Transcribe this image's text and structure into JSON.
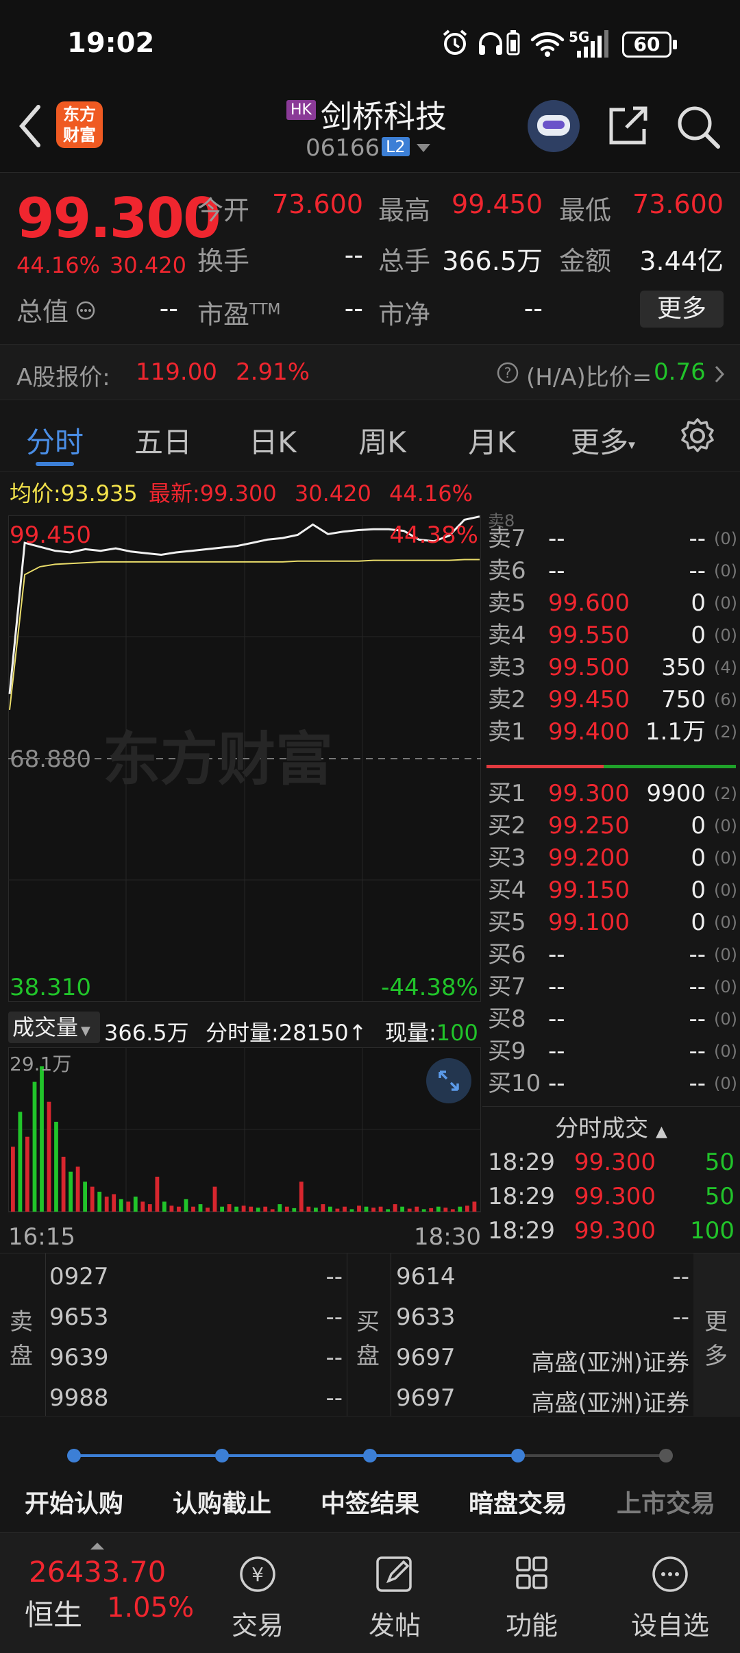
{
  "status_bar": {
    "time": "19:02",
    "network": "5G",
    "battery": "60",
    "icons": [
      "alarm-icon",
      "headphones-icon",
      "battery-saver-icon",
      "wifi-icon",
      "signal-icon",
      "battery-icon"
    ]
  },
  "header": {
    "logo_text_line1": "东方",
    "logo_text_line2": "财富",
    "market_badge": "HK",
    "stock_name": "剑桥科技",
    "stock_code": "06166",
    "level_badge": "L2"
  },
  "quote": {
    "price": "99.300",
    "change_pct": "44.16%",
    "change_amt": "30.420",
    "open_label": "今开",
    "open": "73.600",
    "high_label": "最高",
    "high": "99.450",
    "low_label": "最低",
    "low": "73.600",
    "turnover_rate_label": "换手",
    "turnover_rate": "--",
    "volume_label": "总手",
    "volume": "366.5万",
    "amount_label": "金额",
    "amount": "3.44亿",
    "market_cap_label": "总值",
    "market_cap": "--",
    "pe_label": "市盈",
    "pe_sup": "TTM",
    "pe": "--",
    "pb_label": "市净",
    "pb": "--",
    "more_button": "更多"
  },
  "a_share": {
    "label": "A股报价:",
    "price": "119.00",
    "pct": "2.91%",
    "ha_label": "(H/A)比价=",
    "ha_value": "0.76"
  },
  "tabs": [
    {
      "label": "分时",
      "active": true
    },
    {
      "label": "五日"
    },
    {
      "label": "日K"
    },
    {
      "label": "周K"
    },
    {
      "label": "月K"
    },
    {
      "label": "更多"
    }
  ],
  "avg_line": {
    "avg_label": "均价:",
    "avg": "93.935",
    "latest_label": "最新:",
    "latest": "99.300",
    "chg": "30.420",
    "pct": "44.16%"
  },
  "chart_data": {
    "type": "line",
    "y_top_label": "99.450",
    "y_mid_label": "68.880",
    "y_bottom_label": "38.310",
    "pct_top_label": "44.38%",
    "pct_bottom_label": "-44.38%",
    "watermark": "东方财富",
    "ylim": [
      38.31,
      99.45
    ],
    "series": [
      {
        "values": [
          77.0,
          96.0,
          95.5,
          95.0,
          94.8,
          95.2,
          95.0,
          95.3,
          94.9,
          94.7,
          94.5,
          94.8,
          95.0,
          95.2,
          95.4,
          95.6,
          96.0,
          96.4,
          96.6,
          97.0,
          98.3,
          97.1,
          97.4,
          97.6,
          97.7,
          97.7,
          97.5,
          96.4,
          96.2,
          96.9,
          98.9,
          99.3
        ]
      },
      {
        "values": [
          75.0,
          92.0,
          93.0,
          93.3,
          93.4,
          93.5,
          93.6,
          93.6,
          93.6,
          93.6,
          93.6,
          93.6,
          93.6,
          93.6,
          93.6,
          93.6,
          93.6,
          93.6,
          93.6,
          93.7,
          93.7,
          93.7,
          93.7,
          93.7,
          93.8,
          93.8,
          93.8,
          93.8,
          93.8,
          93.8,
          93.9,
          93.9
        ]
      }
    ],
    "volume": {
      "label": "成交量",
      "total": "366.5万",
      "period_label": "分时量:",
      "period": "28150",
      "current_label": "现量:",
      "current": "100",
      "y_max_label": "29.1万",
      "x_start": "16:15",
      "x_end": "18:30",
      "bars": [
        13,
        20,
        15,
        26,
        29.1,
        22,
        18,
        11,
        8,
        9,
        6,
        5,
        4,
        3,
        3.5,
        2.5,
        2,
        3,
        2,
        1.5,
        7,
        2,
        1.2,
        1,
        2.5,
        1,
        1.5,
        0.8,
        5,
        1,
        1.5,
        1,
        1.2,
        1,
        0.8,
        1,
        0.5,
        1.5,
        1,
        0.7,
        6,
        1,
        0.8,
        1.5,
        1,
        0.6,
        1,
        0.5,
        1.2,
        1,
        0.8,
        1,
        0.5,
        1.5,
        1,
        0.6,
        1,
        0.5,
        0.7,
        1,
        0.8,
        0.5,
        1,
        1.2,
        2
      ],
      "colors": [
        "r",
        "g",
        "r",
        "g",
        "g",
        "r",
        "g",
        "r",
        "g",
        "r",
        "g",
        "r",
        "g",
        "r",
        "r",
        "g",
        "r",
        "g",
        "r",
        "r",
        "r",
        "g",
        "r",
        "r",
        "g",
        "r",
        "g",
        "r",
        "r",
        "g",
        "r",
        "g",
        "r",
        "r",
        "g",
        "r",
        "r",
        "g",
        "r",
        "g",
        "r",
        "r",
        "g",
        "r",
        "g",
        "r",
        "r",
        "g",
        "r",
        "g",
        "r",
        "r",
        "g",
        "r",
        "g",
        "r",
        "r",
        "g",
        "r",
        "g",
        "r",
        "r",
        "g",
        "r",
        "r"
      ]
    }
  },
  "orderbook": {
    "asks": [
      {
        "label": "卖7",
        "price": "--",
        "vol": "--",
        "cnt": "(0)"
      },
      {
        "label": "卖6",
        "price": "--",
        "vol": "--",
        "cnt": "(0)"
      },
      {
        "label": "卖5",
        "price": "99.600",
        "vol": "0",
        "cnt": "(0)"
      },
      {
        "label": "卖4",
        "price": "99.550",
        "vol": "0",
        "cnt": "(0)"
      },
      {
        "label": "卖3",
        "price": "99.500",
        "vol": "350",
        "cnt": "(4)"
      },
      {
        "label": "卖2",
        "price": "99.450",
        "vol": "750",
        "cnt": "(6)"
      },
      {
        "label": "卖1",
        "price": "99.400",
        "vol": "1.1万",
        "cnt": "(2)"
      }
    ],
    "bids": [
      {
        "label": "买1",
        "price": "99.300",
        "vol": "9900",
        "cnt": "(2)"
      },
      {
        "label": "买2",
        "price": "99.250",
        "vol": "0",
        "cnt": "(0)"
      },
      {
        "label": "买3",
        "price": "99.200",
        "vol": "0",
        "cnt": "(0)"
      },
      {
        "label": "买4",
        "price": "99.150",
        "vol": "0",
        "cnt": "(0)"
      },
      {
        "label": "买5",
        "price": "99.100",
        "vol": "0",
        "cnt": "(0)"
      },
      {
        "label": "买6",
        "price": "--",
        "vol": "--",
        "cnt": "(0)"
      },
      {
        "label": "买7",
        "price": "--",
        "vol": "--",
        "cnt": "(0)"
      },
      {
        "label": "买8",
        "price": "--",
        "vol": "--",
        "cnt": "(0)"
      },
      {
        "label": "买9",
        "price": "--",
        "vol": "--",
        "cnt": "(0)"
      },
      {
        "label": "买10",
        "price": "--",
        "vol": "--",
        "cnt": "(0)"
      }
    ],
    "bid_ratio": 0.47
  },
  "trades": {
    "title": "分时成交",
    "rows": [
      {
        "time": "18:29",
        "price": "99.300",
        "vol": "50"
      },
      {
        "time": "18:29",
        "price": "99.300",
        "vol": "50"
      },
      {
        "time": "18:29",
        "price": "99.300",
        "vol": "100"
      }
    ]
  },
  "brokers": {
    "sell_label_1": "卖",
    "sell_label_2": "盘",
    "buy_label_1": "买",
    "buy_label_2": "盘",
    "more_1": "更",
    "more_2": "多",
    "sell": [
      {
        "code": "0927",
        "name": "--"
      },
      {
        "code": "9653",
        "name": "--"
      },
      {
        "code": "9639",
        "name": "--"
      },
      {
        "code": "9988",
        "name": "--"
      }
    ],
    "buy": [
      {
        "code": "9614",
        "name": "--"
      },
      {
        "code": "9633",
        "name": "--"
      },
      {
        "code": "9697",
        "name": "高盛(亚洲)证券"
      },
      {
        "code": "9697",
        "name": "高盛(亚洲)证券"
      }
    ]
  },
  "ipo_timeline": {
    "steps": [
      {
        "label": "开始认购",
        "done": true
      },
      {
        "label": "认购截止",
        "done": true
      },
      {
        "label": "中签结果",
        "done": true
      },
      {
        "label": "暗盘交易",
        "done": true
      },
      {
        "label": "上市交易",
        "done": false
      }
    ]
  },
  "bottom_nav": {
    "index_value": "26433.70",
    "index_name": "恒生",
    "index_pct": "1.05%",
    "items": [
      {
        "label": "交易",
        "icon": "trade-icon"
      },
      {
        "label": "发帖",
        "icon": "post-icon"
      },
      {
        "label": "功能",
        "icon": "apps-icon"
      },
      {
        "label": "设自选",
        "icon": "more-icon"
      }
    ]
  },
  "colors": {
    "up": "#f0262f",
    "down": "#21c42a",
    "avg": "#f3e24b",
    "accent": "#3c7fd6"
  }
}
